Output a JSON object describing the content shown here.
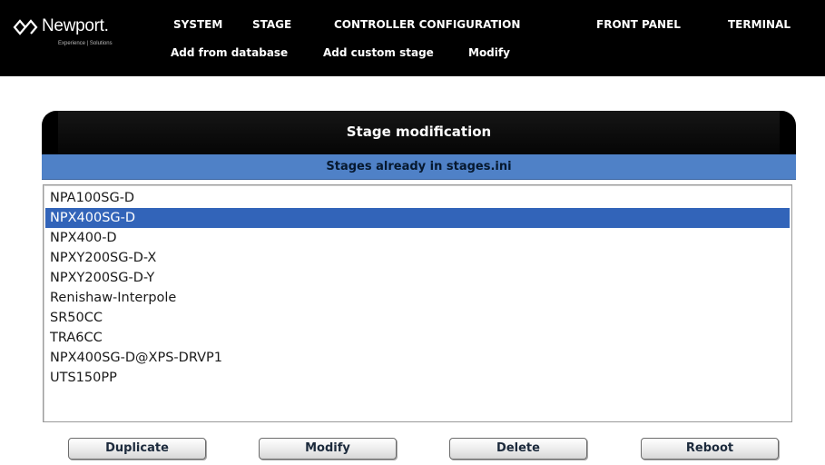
{
  "brand": {
    "name": "Newport.",
    "tagline": "Experience | Solutions"
  },
  "menu": {
    "system": "SYSTEM",
    "stage": "STAGE",
    "controller_configuration": "CONTROLLER CONFIGURATION",
    "front_panel": "FRONT PANEL",
    "terminal": "TERMINAL"
  },
  "submenu": {
    "add_from_database": "Add from database",
    "add_custom_stage": "Add custom stage",
    "modify": "Modify"
  },
  "panel": {
    "title": "Stage modification",
    "list_header": "Stages already in stages.ini"
  },
  "stages": [
    "NPA100SG-D",
    "NPX400SG-D",
    "NPX400-D",
    "NPXY200SG-D-X",
    "NPXY200SG-D-Y",
    "Renishaw-Interpole",
    "SR50CC",
    "TRA6CC",
    "NPX400SG-D@XPS-DRVP1",
    "UTS150PP"
  ],
  "selected_stage": "NPX400SG-D",
  "buttons": {
    "duplicate": "Duplicate",
    "modify": "Modify",
    "delete": "Delete",
    "reboot": "Reboot"
  },
  "colors": {
    "header_bg": "#000000",
    "list_header_bg": "#4f81c7",
    "selection_bg": "#3264b9"
  }
}
